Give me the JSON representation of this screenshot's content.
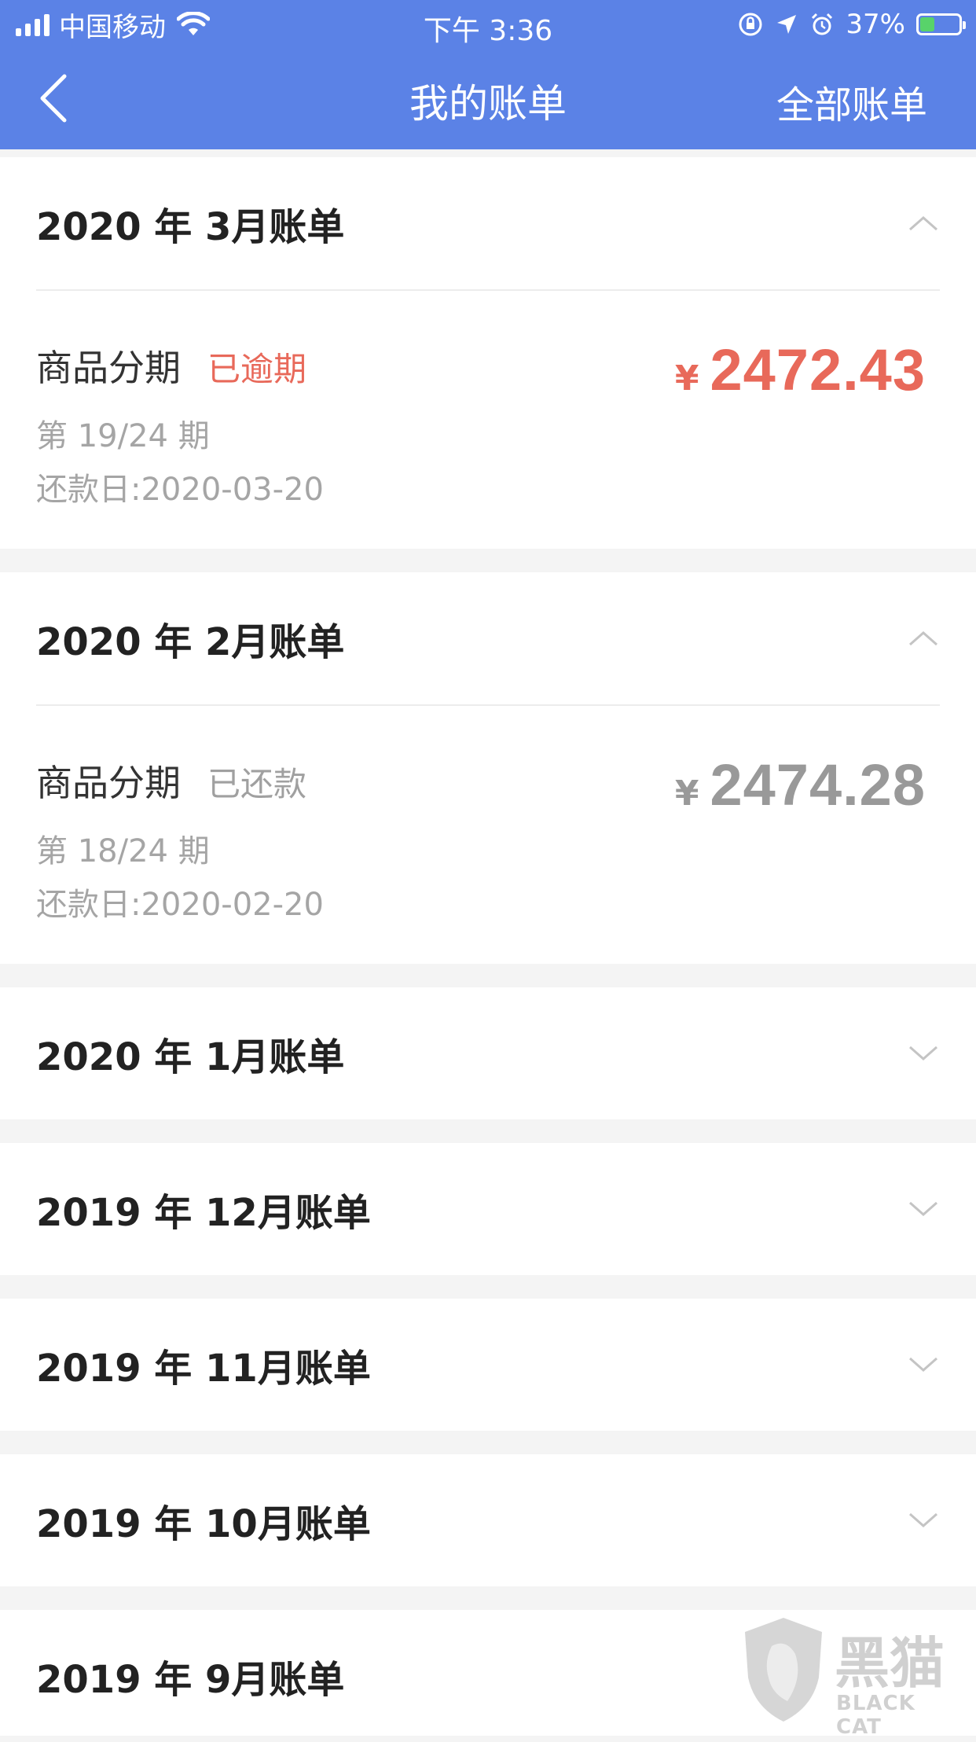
{
  "status_bar": {
    "carrier": "中国移动",
    "time": "下午 3:36",
    "battery": "37%",
    "battery_level": 0.37,
    "icons": [
      "signal-icon",
      "wifi-icon",
      "orientation-lock-icon",
      "location-icon",
      "alarm-icon",
      "battery-icon"
    ]
  },
  "nav": {
    "title": "我的账单",
    "right_label": "全部账单"
  },
  "colors": {
    "header_bg": "#5b82e6",
    "overdue": "#e8695a",
    "paid": "#a0a0a0"
  },
  "bills": [
    {
      "month": "2020 年 3月账单",
      "expanded": true,
      "item": {
        "type": "商品分期",
        "status": "已逾期",
        "period": "第 19/24 期",
        "due_date": "还款日:2020-03-20",
        "currency": "¥",
        "amount": "2472.43"
      }
    },
    {
      "month": "2020 年 2月账单",
      "expanded": true,
      "item": {
        "type": "商品分期",
        "status": "已还款",
        "period": "第 18/24 期",
        "due_date": "还款日:2020-02-20",
        "currency": "¥",
        "amount": "2474.28"
      }
    },
    {
      "month": "2020 年 1月账单",
      "expanded": false
    },
    {
      "month": "2019 年 12月账单",
      "expanded": false
    },
    {
      "month": "2019 年 11月账单",
      "expanded": false
    },
    {
      "month": "2019 年 10月账单",
      "expanded": false
    },
    {
      "month": "2019 年 9月账单",
      "expanded": false
    }
  ],
  "watermark": {
    "text": "黑猫",
    "sub": "BLACK CAT"
  }
}
